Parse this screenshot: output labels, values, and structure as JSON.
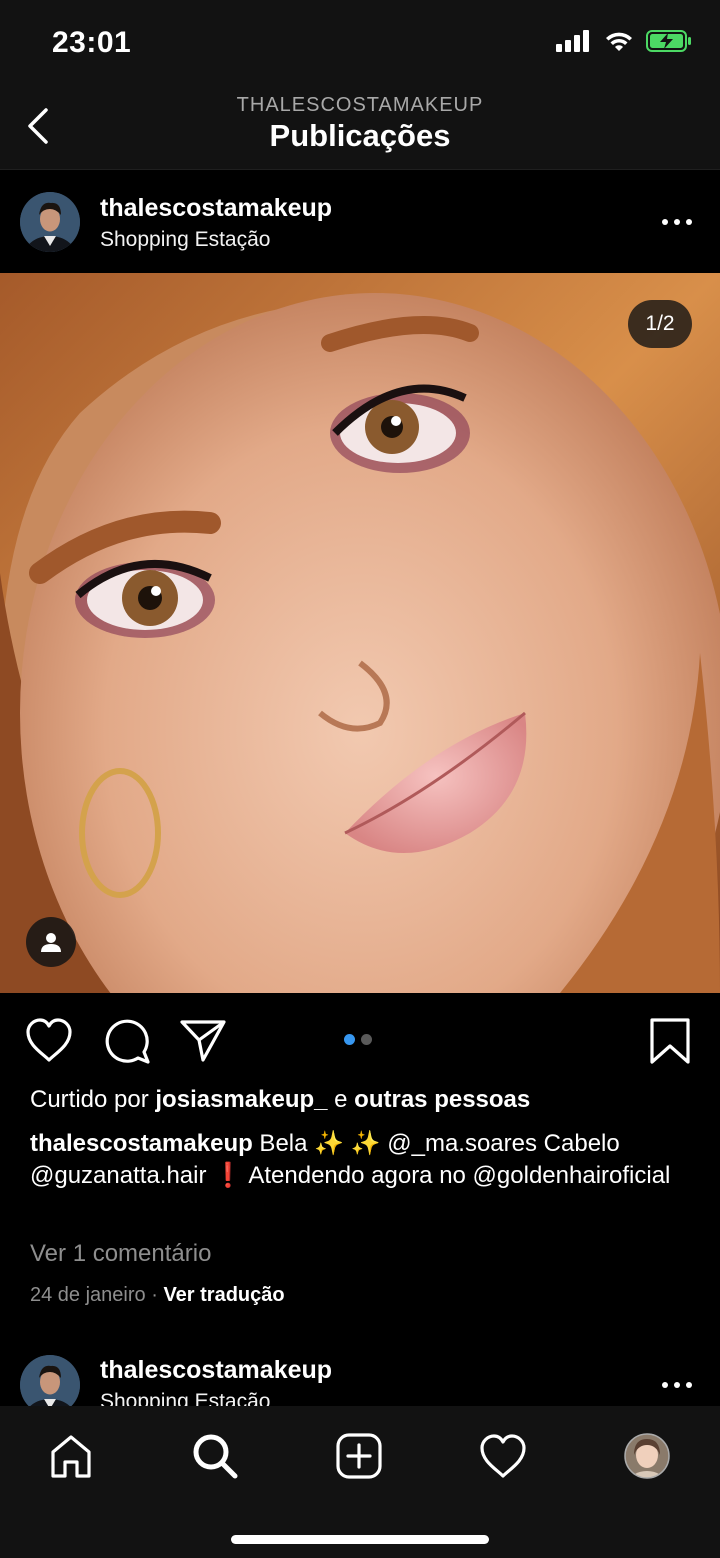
{
  "status": {
    "time": "23:01",
    "icons": [
      "signal-icon",
      "wifi-icon",
      "battery-charging-icon"
    ]
  },
  "nav": {
    "back_icon": "chevron-left-icon",
    "subtitle": "THALESCOSTAMAKEUP",
    "title": "Publicações"
  },
  "post": {
    "username": "thalescostamakeup",
    "location": "Shopping Estação",
    "counter": "1/2",
    "carousel": {
      "current": 1,
      "total": 2
    },
    "likes": {
      "prefix": "Curtido por ",
      "user": "josiasmakeup_",
      "middle": " e ",
      "others": "outras pessoas"
    },
    "caption": {
      "username": "thalescostamakeup",
      "text": " Bela ✨ ✨ @_ma.soares Cabelo @guzanatta.hair ❗ Atendendo agora no @goldenhairoficial"
    },
    "comments_link": "Ver 1 comentário",
    "date": "24 de janeiro",
    "separator": " · ",
    "translate_link": "Ver tradução"
  },
  "next_post": {
    "username": "thalescostamakeup",
    "location": "Shopping Estação"
  },
  "tabs": [
    "home-icon",
    "search-icon",
    "new-post-icon",
    "activity-icon",
    "profile-avatar"
  ],
  "colors": {
    "background": "#000000",
    "header_bg": "#121212",
    "accent_dot": "#3797f0",
    "muted_text": "#8e8e8e"
  }
}
